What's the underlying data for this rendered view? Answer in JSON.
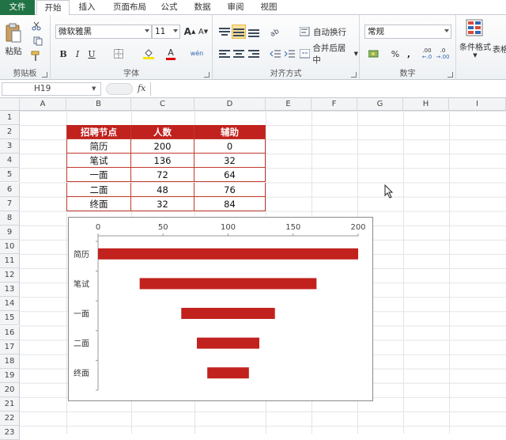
{
  "ribbon": {
    "tabs": [
      "文件",
      "开始",
      "插入",
      "页面布局",
      "公式",
      "数据",
      "审阅",
      "视图"
    ],
    "active_tab": "开始",
    "clipboard": {
      "paste_label": "粘贴",
      "group_label": "剪贴板"
    },
    "font": {
      "name": "微软雅黑",
      "size": "11",
      "group_label": "字体",
      "bold": "B",
      "italic": "I",
      "underline": "U",
      "grow": "A",
      "shrink": "A",
      "color": "A",
      "phonetic": "wén"
    },
    "alignment": {
      "wrap_label": "自动换行",
      "merge_label": "合并后居中",
      "group_label": "对齐方式"
    },
    "number": {
      "format": "常规",
      "group_label": "数字",
      "percent": "%",
      "comma": ",",
      "inc_decimal": ".00",
      "dec_decimal": ".0"
    },
    "styles": {
      "conditional_label": "条件格式",
      "table_label": "表格"
    }
  },
  "formula_bar": {
    "name_box": "H19",
    "fx": "fx"
  },
  "columns": [
    "A",
    "B",
    "C",
    "D",
    "E",
    "F",
    "G",
    "H",
    "I"
  ],
  "rows": [
    "1",
    "2",
    "3",
    "4",
    "5",
    "6",
    "7",
    "8",
    "9",
    "10",
    "11",
    "12",
    "13",
    "14",
    "15",
    "16",
    "17",
    "18",
    "19",
    "20",
    "21",
    "22",
    "23"
  ],
  "table": {
    "headers": [
      "招聘节点",
      "人数",
      "辅助"
    ],
    "rows": [
      [
        "简历",
        "200",
        "0"
      ],
      [
        "笔试",
        "136",
        "32"
      ],
      [
        "一面",
        "72",
        "64"
      ],
      [
        "二面",
        "48",
        "76"
      ],
      [
        "终面",
        "32",
        "84"
      ]
    ]
  },
  "colors": {
    "accent": "#c1221e",
    "file_tab": "#217346"
  },
  "chart_data": {
    "type": "bar",
    "orientation": "horizontal-stacked",
    "categories": [
      "简历",
      "笔试",
      "一面",
      "二面",
      "终面"
    ],
    "series": [
      {
        "values": [
          0,
          32,
          64,
          76,
          84
        ],
        "color": "none"
      },
      {
        "values": [
          200,
          136,
          72,
          48,
          32
        ],
        "color": "#c1221e"
      }
    ],
    "x_ticks": [
      "0",
      "50",
      "100",
      "150",
      "200"
    ],
    "xlim": [
      0,
      200
    ],
    "x_axis_position": "top",
    "grid": false,
    "legend": "none"
  }
}
